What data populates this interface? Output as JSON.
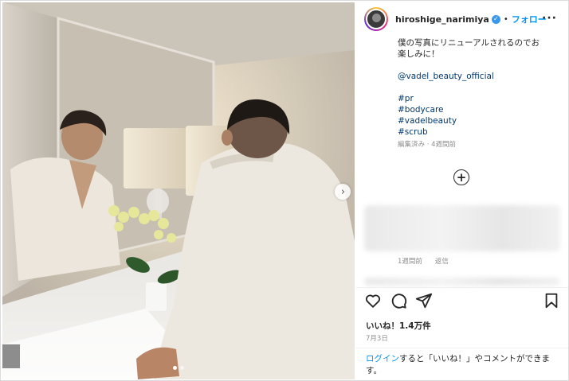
{
  "post": {
    "username": "hiroshige_narimiya",
    "separator": "•",
    "follow_label": "フォロー",
    "more_label": "···",
    "verified_icon": "verified-badge-icon"
  },
  "caption": {
    "lines": [
      "僕の写真にリニューアルされるのでお",
      "楽しみに！"
    ],
    "mention": "@vadel_beauty_official",
    "hashtags": [
      "#pr",
      "#bodycare",
      "#vadelbeauty",
      "#scrub"
    ],
    "edited": "編集済み · 4週間前"
  },
  "comment_meta": {
    "time": "1週間前",
    "reply": "返信"
  },
  "likes": "いいね！1.4万件",
  "date": "7月3日",
  "login": {
    "link": "ログイン",
    "rest": "すると「いいね！」やコメントができます。"
  },
  "carousel": {
    "current": 1,
    "total": 2
  },
  "colors": {
    "accent": "#0095f6",
    "link": "#00376b",
    "muted": "#8e8e8e"
  }
}
